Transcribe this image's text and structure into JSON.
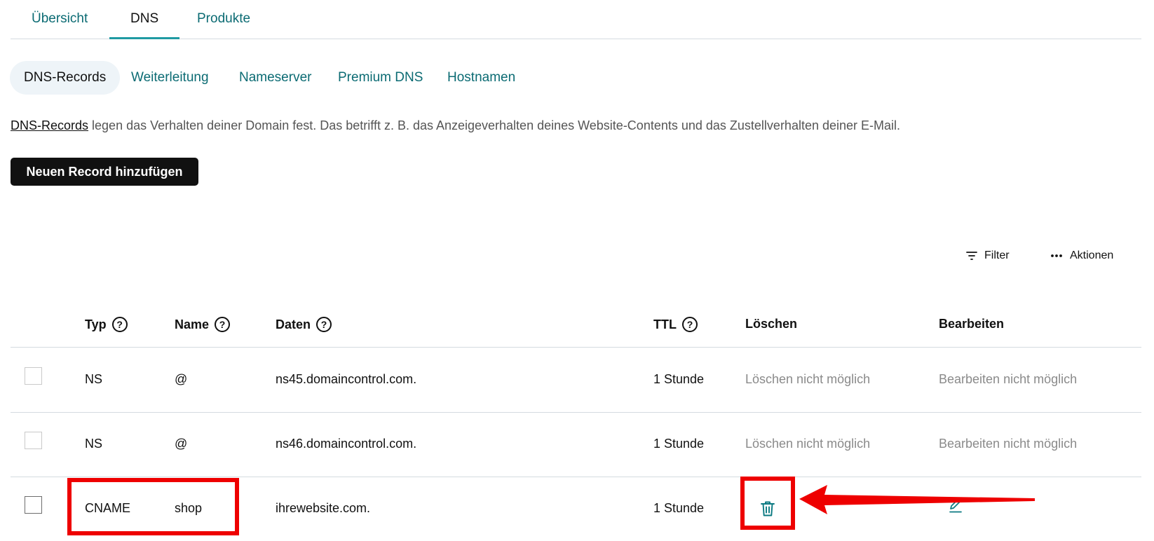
{
  "top_tabs": [
    {
      "label": "Übersicht",
      "active": false
    },
    {
      "label": "DNS",
      "active": true
    },
    {
      "label": "Produkte",
      "active": false
    }
  ],
  "sub_tabs": [
    {
      "label": "DNS-Records",
      "active": true
    },
    {
      "label": "Weiterleitung",
      "active": false
    },
    {
      "label": "Nameserver",
      "active": false
    },
    {
      "label": "Premium DNS",
      "active": false
    },
    {
      "label": "Hostnamen",
      "active": false
    }
  ],
  "description": {
    "link": "DNS-Records",
    "text": " legen das Verhalten deiner Domain fest. Das betrifft z. B. das Anzeigeverhalten deines Website-Contents und das Zustellverhalten deiner E-Mail."
  },
  "add_button": "Neuen Record hinzufügen",
  "toolbar": {
    "filter": "Filter",
    "actions": "Aktionen"
  },
  "table": {
    "headers": {
      "typ": "Typ",
      "name": "Name",
      "daten": "Daten",
      "ttl": "TTL",
      "loeschen": "Löschen",
      "bearbeiten": "Bearbeiten"
    },
    "help_glyph": "?",
    "rows": [
      {
        "typ": "NS",
        "name": "@",
        "daten": "ns45.domaincontrol.com.",
        "ttl": "1 Stunde",
        "loeschen": "Löschen nicht möglich",
        "bearbeiten": "Bearbeiten nicht möglich"
      },
      {
        "typ": "NS",
        "name": "@",
        "daten": "ns46.domaincontrol.com.",
        "ttl": "1 Stunde",
        "loeschen": "Löschen nicht möglich",
        "bearbeiten": "Bearbeiten nicht möglich"
      },
      {
        "typ": "CNAME",
        "name": "shop",
        "daten": "ihrewebsite.com.",
        "ttl": "1 Stunde",
        "loeschen_icon": "trash-icon",
        "bearbeiten_icon": "pencil-icon"
      }
    ]
  },
  "icons": {
    "filter": "filter-icon",
    "actions": "more-horizontal-icon",
    "help": "help-circle-icon",
    "delete": "trash-icon",
    "edit": "pencil-icon",
    "arrow": "arrow-left-icon"
  },
  "colors": {
    "accent": "#0b6b73",
    "tab_underline": "#1f9aa3",
    "annotation": "#ee0000",
    "button": "#111111"
  }
}
